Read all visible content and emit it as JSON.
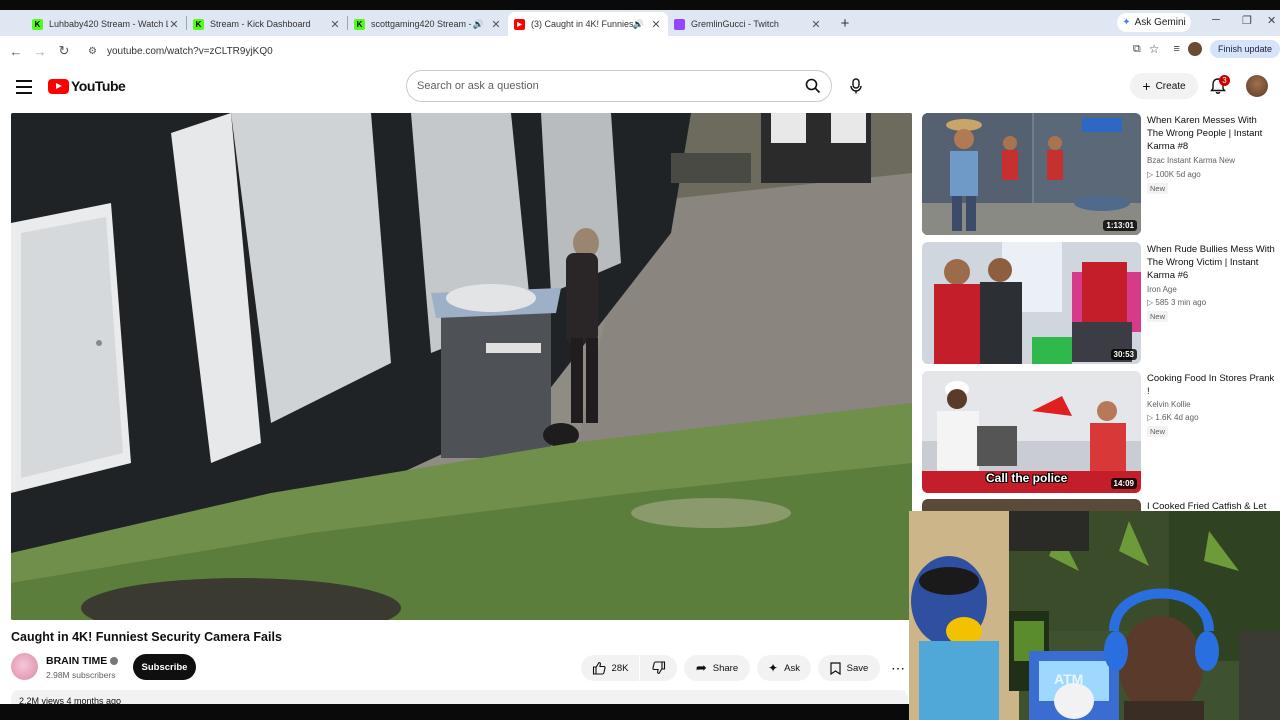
{
  "browser": {
    "tabs": [
      {
        "title": "Luhbaby420 Stream - Watch Li",
        "favicon": "kick-icon",
        "color": "#53fc18",
        "speaker": false
      },
      {
        "title": "Stream - Kick Dashboard",
        "favicon": "kick-icon",
        "color": "#53fc18",
        "speaker": false
      },
      {
        "title": "scottgaming420 Stream - W",
        "favicon": "kick-icon",
        "color": "#53fc18",
        "speaker": true
      },
      {
        "title": "(3) Caught in 4K! Funniest S",
        "favicon": "youtube-icon",
        "color": "#ff0000",
        "speaker": true,
        "active": true
      },
      {
        "title": "GremlinGucci - Twitch",
        "favicon": "twitch-icon",
        "color": "#9146ff",
        "speaker": false
      }
    ],
    "new_tab": "+",
    "ask_gemini": "Ask Gemini",
    "url": "youtube.com/watch?v=zCLTR9yjKQ0",
    "finish_update": "Finish update"
  },
  "youtube": {
    "logo_text": "YouTube",
    "search_placeholder": "Search or ask a question",
    "create_label": "Create",
    "notification_count": "3",
    "video": {
      "title": "Caught in 4K! Funniest Security Camera Fails",
      "channel": "BRAIN TIME",
      "subscribers": "2.98M subscribers",
      "subscribe_label": "Subscribe",
      "likes": "28K",
      "share_label": "Share",
      "ask_label": "Ask",
      "save_label": "Save",
      "views_partial": "2.2M views  4 months ago"
    },
    "recommendations": [
      {
        "title": "When Karen Messes With The Wrong People | Instant Karma #8",
        "channel": "Bzac Instant Karma New",
        "meta": "▷ 100K  5d ago",
        "badge": "New",
        "duration": "1:13:01"
      },
      {
        "title": "When Rude Bullies Mess With The Wrong Victim | Instant Karma #6",
        "channel": "Iron Age",
        "meta": "▷ 585  3 min ago",
        "badge": "New",
        "duration": "30:53"
      },
      {
        "title": "Cooking Food In Stores Prank !",
        "channel": "Kelvin Kollie",
        "meta": "▷ 1.6K  4d ago",
        "badge": "New",
        "duration": "14:09",
        "overlay_text": "Call the police"
      },
      {
        "title": "I Cooked Fried Catfish & Let",
        "channel": "",
        "meta": "",
        "badge": "",
        "duration": ""
      }
    ]
  },
  "webcam": {
    "sign_text": "ATM"
  }
}
